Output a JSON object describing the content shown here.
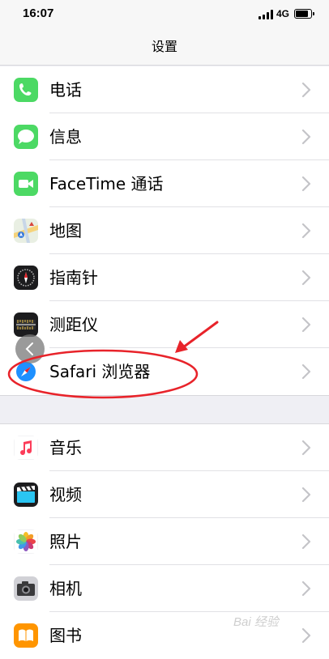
{
  "status_bar": {
    "time": "16:07",
    "network": "4G"
  },
  "nav": {
    "title": "设置"
  },
  "group1": [
    {
      "id": "phone",
      "label": "电话",
      "icon": "phone-icon"
    },
    {
      "id": "messages",
      "label": "信息",
      "icon": "messages-icon"
    },
    {
      "id": "facetime",
      "label": "FaceTime 通话",
      "icon": "facetime-icon"
    },
    {
      "id": "maps",
      "label": "地图",
      "icon": "maps-icon"
    },
    {
      "id": "compass",
      "label": "指南针",
      "icon": "compass-icon"
    },
    {
      "id": "measure",
      "label": "测距仪",
      "icon": "measure-icon"
    },
    {
      "id": "safari",
      "label": "Safari 浏览器",
      "icon": "safari-icon"
    }
  ],
  "group2": [
    {
      "id": "music",
      "label": "音乐",
      "icon": "music-icon"
    },
    {
      "id": "videos",
      "label": "视频",
      "icon": "videos-icon"
    },
    {
      "id": "photos",
      "label": "照片",
      "icon": "photos-icon"
    },
    {
      "id": "camera",
      "label": "相机",
      "icon": "camera-icon"
    },
    {
      "id": "books",
      "label": "图书",
      "icon": "books-icon"
    }
  ],
  "colors": {
    "annotation_red": "#e8232a",
    "phone_green": "#4cd964",
    "books_orange": "#ff9500"
  },
  "watermark": "Bai 经验"
}
